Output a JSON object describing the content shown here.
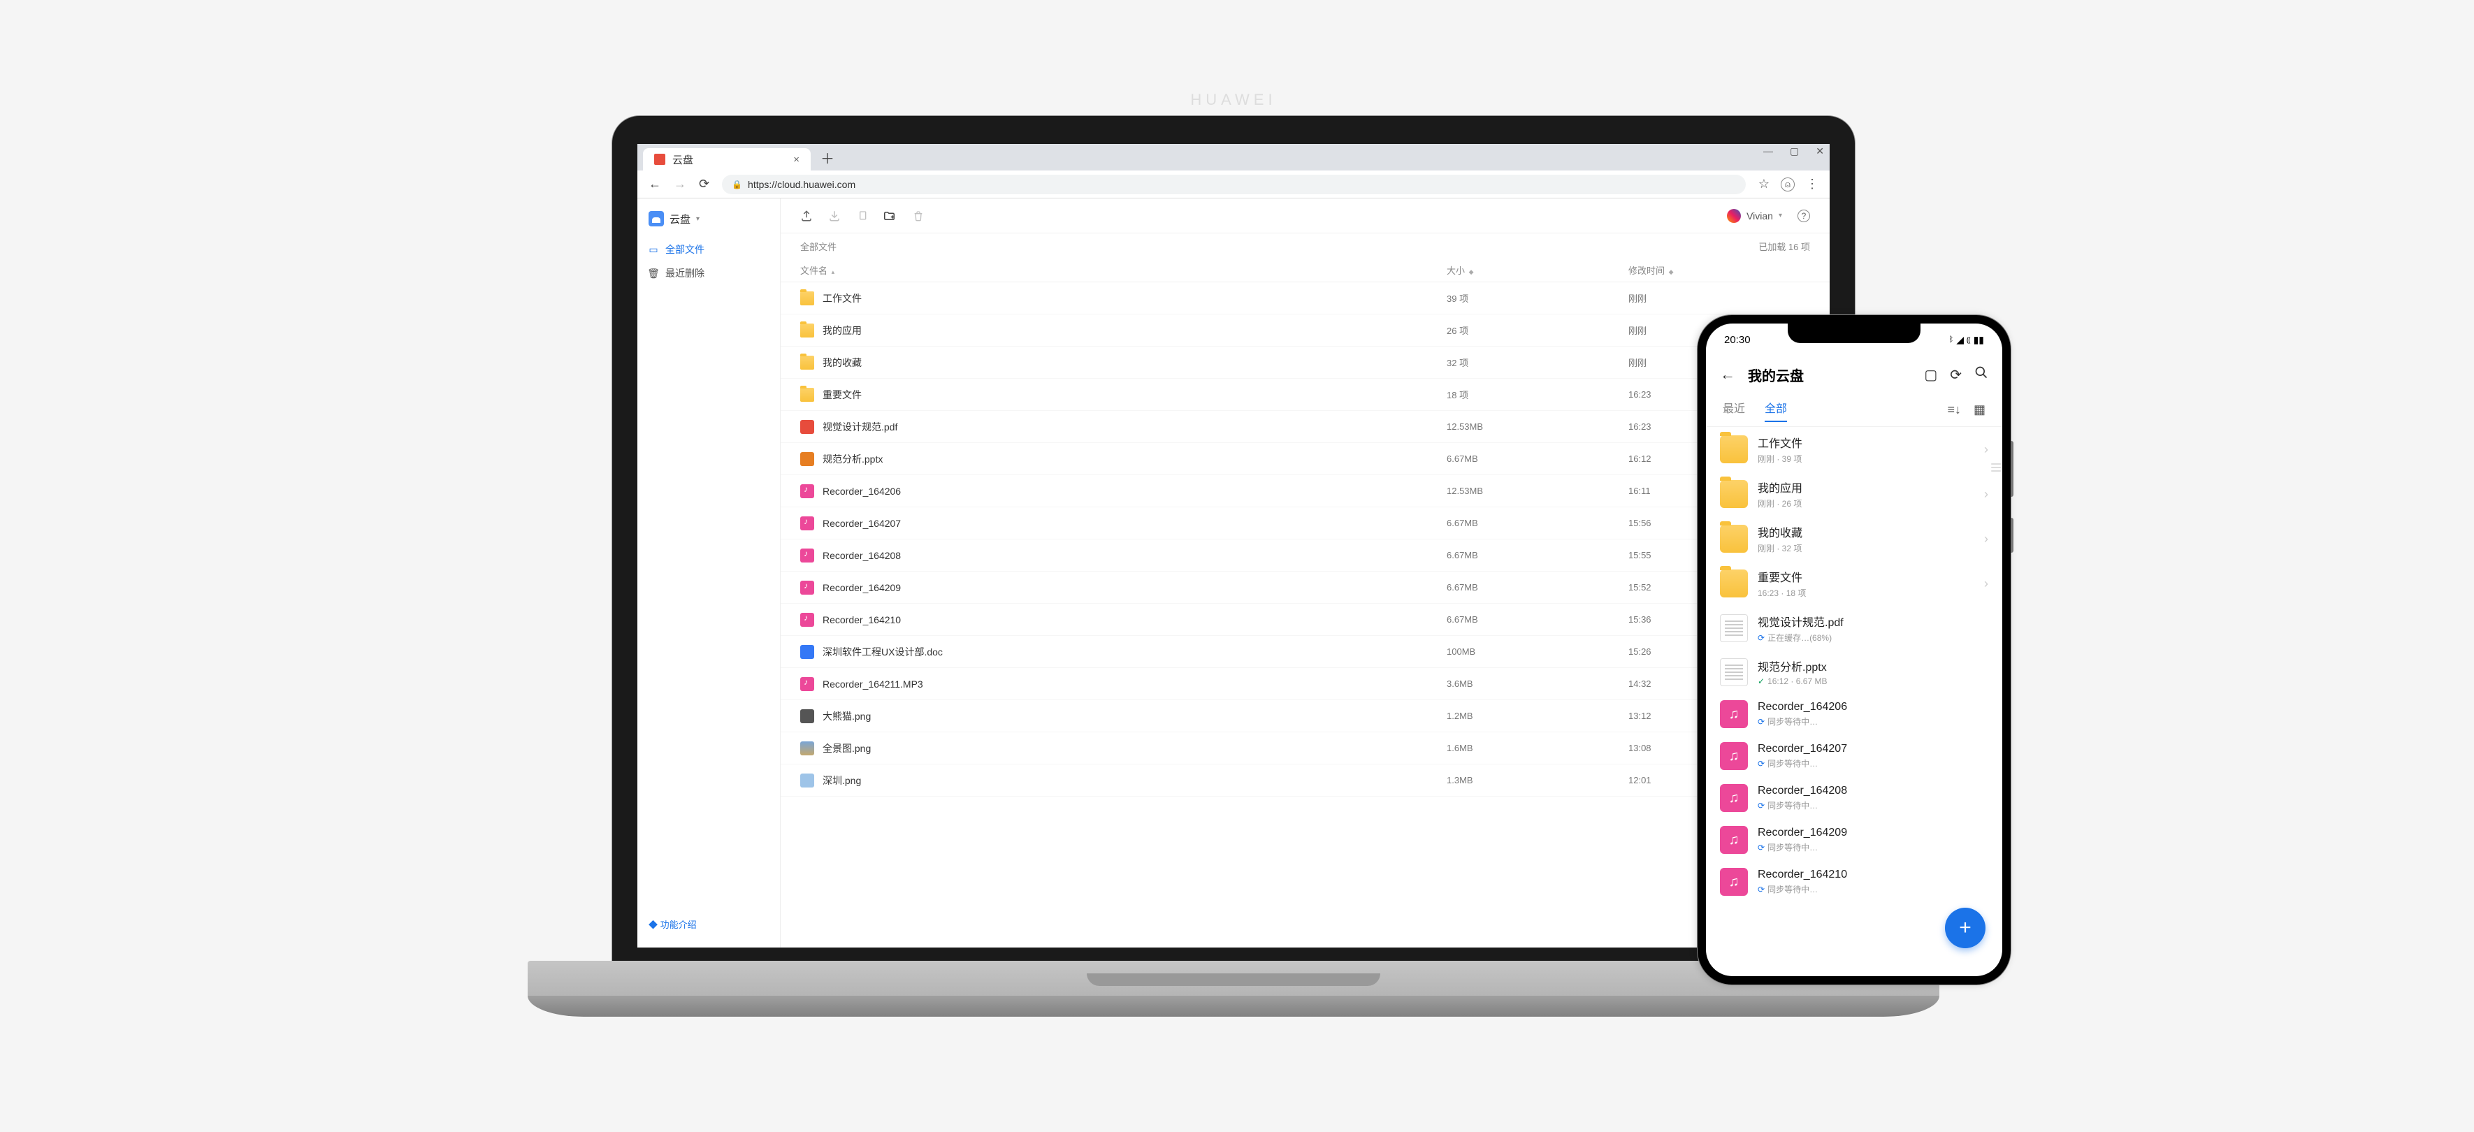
{
  "laptop_brand": "HUAWEI",
  "browser": {
    "tab_title": "云盘",
    "url": "https://cloud.huawei.com"
  },
  "sidebar": {
    "app_name": "云盘",
    "items": [
      {
        "label": "全部文件"
      },
      {
        "label": "最近删除"
      }
    ],
    "footer": "功能介绍"
  },
  "toolbar": {
    "user_name": "Vivian"
  },
  "crumb": {
    "path": "全部文件",
    "count": "已加载 16 项"
  },
  "columns": {
    "name": "文件名",
    "size": "大小",
    "time": "修改时间"
  },
  "files": [
    {
      "name": "工作文件",
      "size": "39 项",
      "time": "刚刚",
      "icon": "folder"
    },
    {
      "name": "我的应用",
      "size": "26 项",
      "time": "刚刚",
      "icon": "folder"
    },
    {
      "name": "我的收藏",
      "size": "32 项",
      "time": "刚刚",
      "icon": "folder"
    },
    {
      "name": "重要文件",
      "size": "18 项",
      "time": "16:23",
      "icon": "folder"
    },
    {
      "name": "视觉设计规范.pdf",
      "size": "12.53MB",
      "time": "16:23",
      "icon": "pdf"
    },
    {
      "name": "规范分析.pptx",
      "size": "6.67MB",
      "time": "16:12",
      "icon": "pptx"
    },
    {
      "name": "Recorder_164206",
      "size": "12.53MB",
      "time": "16:11",
      "icon": "audio"
    },
    {
      "name": "Recorder_164207",
      "size": "6.67MB",
      "time": "15:56",
      "icon": "audio"
    },
    {
      "name": "Recorder_164208",
      "size": "6.67MB",
      "time": "15:55",
      "icon": "audio"
    },
    {
      "name": "Recorder_164209",
      "size": "6.67MB",
      "time": "15:52",
      "icon": "audio"
    },
    {
      "name": "Recorder_164210",
      "size": "6.67MB",
      "time": "15:36",
      "icon": "audio"
    },
    {
      "name": "深圳软件工程UX设计部.doc",
      "size": "100MB",
      "time": "15:26",
      "icon": "doc"
    },
    {
      "name": "Recorder_164211.MP3",
      "size": "3.6MB",
      "time": "14:32",
      "icon": "audio"
    },
    {
      "name": "大熊猫.png",
      "size": "1.2MB",
      "time": "13:12",
      "icon": "img1"
    },
    {
      "name": "全景图.png",
      "size": "1.6MB",
      "time": "13:08",
      "icon": "img2"
    },
    {
      "name": "深圳.png",
      "size": "1.3MB",
      "time": "12:01",
      "icon": "img3"
    }
  ],
  "phone": {
    "time": "20:30",
    "title": "我的云盘",
    "tabs": {
      "recent": "最近",
      "all": "全部"
    },
    "items": [
      {
        "name": "工作文件",
        "meta": "刚刚 · 39 项",
        "icon": "folder",
        "chev": true
      },
      {
        "name": "我的应用",
        "meta": "刚刚 · 26 项",
        "icon": "folder",
        "chev": true
      },
      {
        "name": "我的收藏",
        "meta": "刚刚 · 32 项",
        "icon": "folder",
        "chev": true
      },
      {
        "name": "重要文件",
        "meta": "16:23 · 18 项",
        "icon": "folder",
        "chev": true
      },
      {
        "name": "视觉设计规范.pdf",
        "meta": "正在缓存…(68%)",
        "icon": "docfile",
        "status": "sync"
      },
      {
        "name": "规范分析.pptx",
        "meta": "16:12 · 6.67 MB",
        "icon": "docfile",
        "status": "done"
      },
      {
        "name": "Recorder_164206",
        "meta": "同步等待中…",
        "icon": "audio",
        "status": "sync"
      },
      {
        "name": "Recorder_164207",
        "meta": "同步等待中…",
        "icon": "audio",
        "status": "sync"
      },
      {
        "name": "Recorder_164208",
        "meta": "同步等待中…",
        "icon": "audio",
        "status": "sync"
      },
      {
        "name": "Recorder_164209",
        "meta": "同步等待中…",
        "icon": "audio",
        "status": "sync"
      },
      {
        "name": "Recorder_164210",
        "meta": "同步等待中…",
        "icon": "audio",
        "status": "sync"
      }
    ]
  }
}
